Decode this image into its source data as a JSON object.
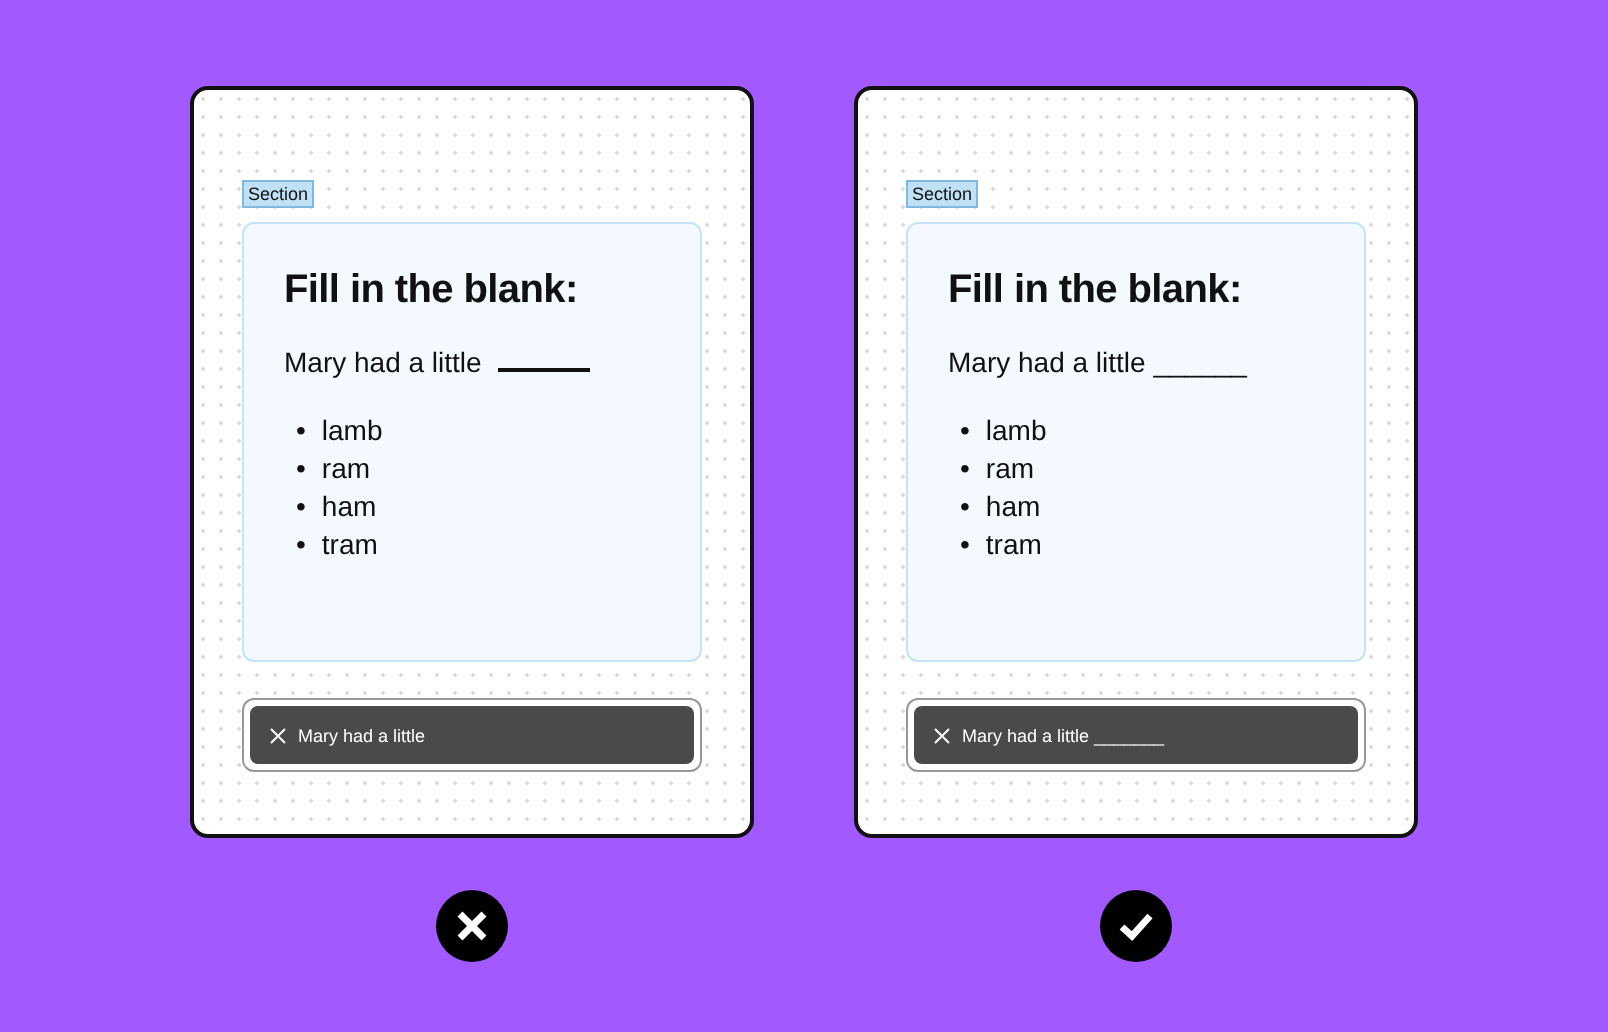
{
  "panels": [
    {
      "correct": false,
      "section_tag": "Section",
      "title": "Fill in the blank:",
      "sentence": "Mary had a little",
      "blank_line": true,
      "options": [
        {
          "bullet": "•",
          "text": "lamb"
        },
        {
          "bullet": "•",
          "text": "ram"
        },
        {
          "bullet": "•",
          "text": "ham"
        },
        {
          "bullet": "•",
          "text": "tram"
        }
      ],
      "toast": "Mary had a little"
    },
    {
      "correct": true,
      "section_tag": "Section",
      "title": "Fill in the blank:",
      "sentence": "Mary had a little ______",
      "blank_line": false,
      "options": [
        {
          "bullet": "•",
          "text": "lamb"
        },
        {
          "bullet": "•",
          "text": "ram"
        },
        {
          "bullet": "•",
          "text": "ham"
        },
        {
          "bullet": "•",
          "text": "tram"
        }
      ],
      "toast": "Mary had a little _______"
    }
  ]
}
